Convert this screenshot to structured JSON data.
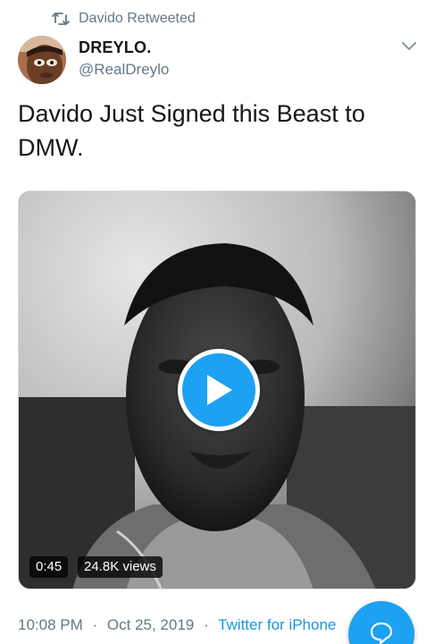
{
  "retweet": {
    "icon": "retweet-icon",
    "label": "Davido Retweeted"
  },
  "author": {
    "display_name": "DREYLO.",
    "handle": "@RealDreylo",
    "avatar_icon": "avatar"
  },
  "tweet": {
    "text": "Davido Just Signed this Beast to DMW."
  },
  "media": {
    "duration": "0:45",
    "views": "24.8K views",
    "play_icon": "play-icon"
  },
  "meta": {
    "time": "10:08 PM",
    "date": "Oct 25, 2019",
    "separator": "·",
    "source": "Twitter for iPhone"
  },
  "colors": {
    "accent": "#1da1f2",
    "secondary_text": "#657786",
    "link": "#1b95e0"
  },
  "fab": {
    "icon": "compose-reply-icon"
  }
}
